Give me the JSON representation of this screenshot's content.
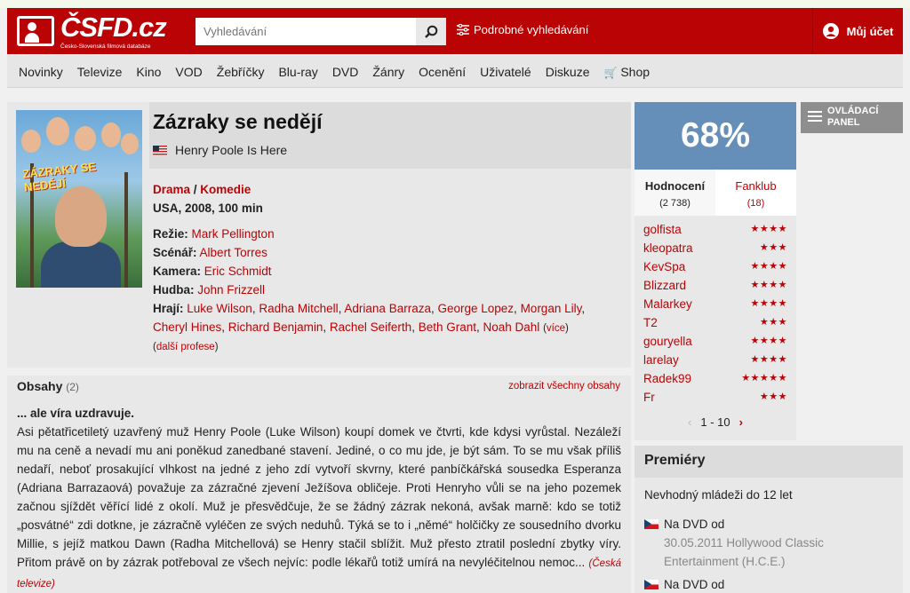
{
  "header": {
    "logo_text": "ČSFD.cz",
    "logo_tagline": "Česko-Slovenská filmová databáze",
    "search_placeholder": "Vyhledávání",
    "advanced_search": "Podrobné vyhledávání",
    "account": "Můj účet",
    "brand_color": "#ba0305"
  },
  "nav": [
    "Novinky",
    "Televize",
    "Kino",
    "VOD",
    "Žebříčky",
    "Blu-ray",
    "DVD",
    "Žánry",
    "Ocenění",
    "Uživatelé",
    "Diskuze",
    "Shop"
  ],
  "film": {
    "title": "Zázraky se nedějí",
    "original_title": "Henry Poole Is Here",
    "poster_title": "ZÁZRAKY SE NEDĚJÍ",
    "genres": [
      "Drama",
      "Komedie"
    ],
    "genre_sep": " / ",
    "origin": "USA, 2008, 100 min",
    "director_label": "Režie:",
    "director": "Mark Pellington",
    "writer_label": "Scénář:",
    "writer": "Albert Torres",
    "camera_label": "Kamera:",
    "camera": "Eric Schmidt",
    "music_label": "Hudba:",
    "music": "John Frizzell",
    "cast_label": "Hrají:",
    "cast": [
      "Luke Wilson",
      "Radha Mitchell",
      "Adriana Barraza",
      "George Lopez",
      "Morgan Lily",
      "Cheryl Hines",
      "Richard Benjamin",
      "Rachel Seiferth",
      "Beth Grant",
      "Noah Dahl"
    ],
    "more_cast": "více",
    "more_professions": "další profese"
  },
  "plot": {
    "heading": "Obsahy",
    "count": "(2)",
    "show_all": "zobrazit všechny obsahy",
    "tagline": "... ale víra uzdravuje.",
    "text": "Asi pětatřicetiletý uzavřený muž Henry Poole (Luke Wilson) koupí domek ve čtvrti, kde kdysi vyrůstal. Nezáleží mu na ceně a nevadí mu ani poněkud zanedbané stavení. Jediné, o co mu jde, je být sám. To se mu však příliš nedaří, neboť prosakující vlhkost na jedné z jeho zdí vytvoří skvrny, které panbíčkářská sousedka Esperanza (Adriana Barrazaová) považuje za zázračné zjevení Ježíšova obličeje. Proti Henryho vůli se na jeho pozemek začnou sjíždět věřící lidé z okolí. Muž je přesvědčuje, že se žádný zázrak nekoná, avšak marně: kdo se totiž „posvátné“ zdi dotkne, je zázračně vyléčen ze svých neduhů. Týká se to i „němé“ holčičky ze sousedního dvorku Millie, s jejíž matkou Dawn (Radha Mitchellová) se Henry stačil sblížit. Muž přesto ztratil poslední zbytky víry. Přitom právě on by zázrak potřeboval ze všech nejvíc: podle lékařů totiž umírá na nevyléčitelnou nemoc...",
    "source": "(Česká televize)"
  },
  "rating": {
    "percent": "68%",
    "color": "#658fb9",
    "tab_ratings": "Hodnocení",
    "tab_ratings_count": "(2 738)",
    "tab_fanclub": "Fanklub",
    "tab_fanclub_count": "(18)",
    "users": [
      {
        "name": "golfista",
        "stars": "★★★★"
      },
      {
        "name": "kleopatra",
        "stars": "★★★"
      },
      {
        "name": "KevSpa",
        "stars": "★★★★"
      },
      {
        "name": "Blizzard",
        "stars": "★★★★"
      },
      {
        "name": "Malarkey",
        "stars": "★★★★"
      },
      {
        "name": "T2",
        "stars": "★★★"
      },
      {
        "name": "gouryella",
        "stars": "★★★★"
      },
      {
        "name": "larelay",
        "stars": "★★★★"
      },
      {
        "name": "Radek99",
        "stars": "★★★★★"
      },
      {
        "name": "Fr",
        "stars": "★★★"
      }
    ],
    "pager": "1 - 10"
  },
  "control_panel": {
    "line1": "OVLÁDACÍ",
    "line2": "PANEL"
  },
  "premieres": {
    "heading": "Premiéry",
    "age": "Nevhodný mládeži do 12 let",
    "entries": [
      {
        "label": "Na DVD od",
        "date": "30.05.2011 Hollywood Classic",
        "company": "Entertainment (H.C.E.)"
      },
      {
        "label": "Na DVD od"
      }
    ]
  }
}
